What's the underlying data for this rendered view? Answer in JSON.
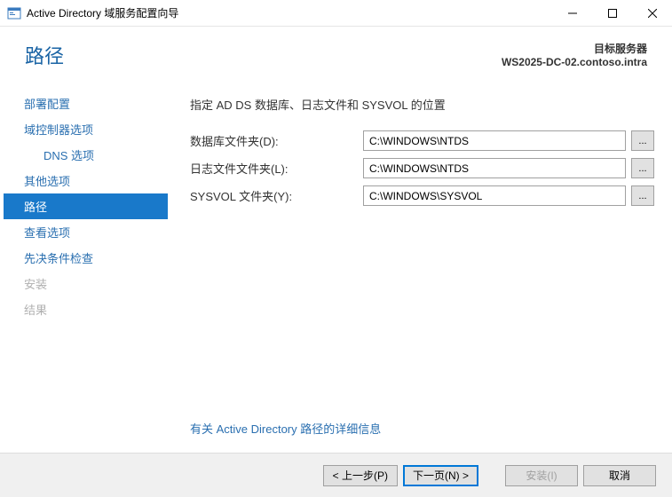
{
  "window": {
    "title": "Active Directory 域服务配置向导"
  },
  "header": {
    "heading": "路径",
    "target_label": "目标服务器",
    "target_name": "WS2025-DC-02.contoso.intra"
  },
  "sidebar": {
    "items": [
      {
        "label": "部署配置",
        "state": "normal"
      },
      {
        "label": "域控制器选项",
        "state": "normal"
      },
      {
        "label": "DNS 选项",
        "state": "sub"
      },
      {
        "label": "其他选项",
        "state": "normal"
      },
      {
        "label": "路径",
        "state": "selected"
      },
      {
        "label": "查看选项",
        "state": "normal"
      },
      {
        "label": "先决条件检查",
        "state": "normal"
      },
      {
        "label": "安装",
        "state": "disabled"
      },
      {
        "label": "结果",
        "state": "disabled"
      }
    ]
  },
  "content": {
    "title": "指定 AD DS 数据库、日志文件和 SYSVOL 的位置",
    "rows": [
      {
        "label": "数据库文件夹(D):",
        "value": "C:\\WINDOWS\\NTDS"
      },
      {
        "label": "日志文件文件夹(L):",
        "value": "C:\\WINDOWS\\NTDS"
      },
      {
        "label": "SYSVOL 文件夹(Y):",
        "value": "C:\\WINDOWS\\SYSVOL"
      }
    ],
    "browse_label": "...",
    "more_info": "有关 Active Directory 路径的详细信息"
  },
  "footer": {
    "previous": "< 上一步(P)",
    "next": "下一页(N) >",
    "install": "安装(I)",
    "cancel": "取消"
  }
}
